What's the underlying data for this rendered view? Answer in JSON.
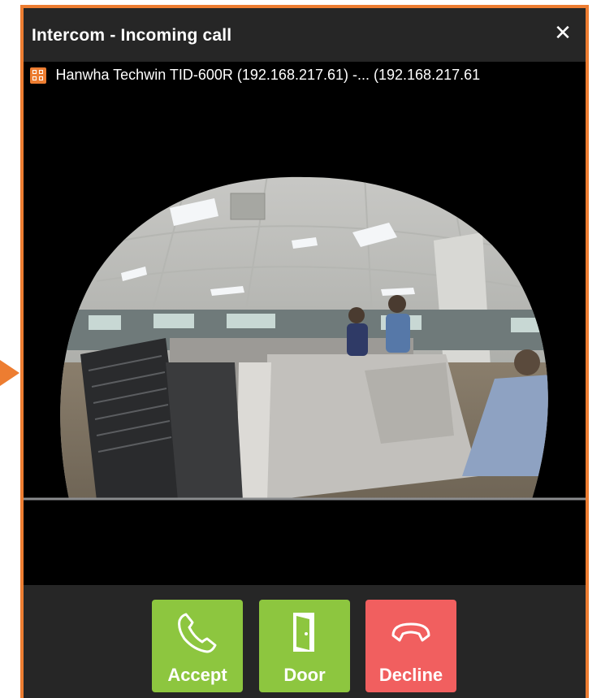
{
  "window": {
    "title": "Intercom - Incoming call",
    "close_glyph": "✕",
    "device_label": "Hanwha Techwin TID-600R (192.168.217.61) -... (192.168.217.61",
    "device_icon": "camera-icon"
  },
  "video": {
    "content": "fisheye-office-feed"
  },
  "actions": [
    {
      "label": "Accept",
      "icon": "phone-icon",
      "color": "#8dc63f"
    },
    {
      "label": "Door",
      "icon": "door-icon",
      "color": "#8dc63f"
    },
    {
      "label": "Decline",
      "icon": "hang-up-icon",
      "color": "#f15f5f"
    }
  ],
  "colors": {
    "accent_border": "#ed7d31",
    "titlebar_bg": "#262626",
    "video_bg": "#000000"
  }
}
